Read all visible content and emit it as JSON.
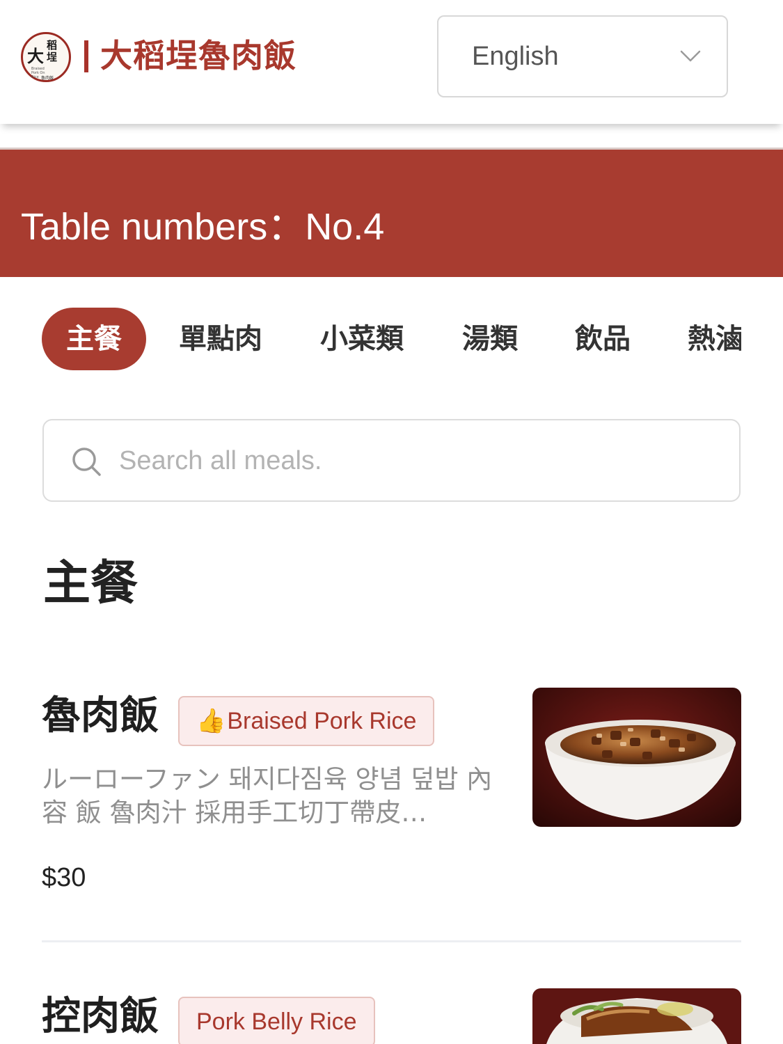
{
  "header": {
    "logo": {
      "big": "大",
      "small": "稻埕",
      "tiny": "Braised Pork On Rice",
      "mini": "魯肉飯"
    },
    "restaurant_name": "大稻埕魯肉飯",
    "language": {
      "selected": "English",
      "icon": "chevron-down-icon"
    }
  },
  "banner": {
    "table_label": "Table numbers：No.4"
  },
  "categories": [
    {
      "label": "主餐",
      "active": true
    },
    {
      "label": "單點肉",
      "active": false
    },
    {
      "label": "小菜類",
      "active": false
    },
    {
      "label": "湯類",
      "active": false
    },
    {
      "label": "飲品",
      "active": false
    },
    {
      "label": "熱滷",
      "active": false
    }
  ],
  "search": {
    "placeholder": "Search all meals.",
    "icon": "search-icon"
  },
  "section": {
    "title": "主餐"
  },
  "items": [
    {
      "name": "魯肉飯",
      "tag_icon": "👍",
      "tag": "Braised Pork Rice",
      "description": "ルーローファン 돼지다짐육 양념 덮밥 內容 飯 魯肉汁 採用手工切丁帶皮…",
      "price": "$30"
    },
    {
      "name": "控肉飯",
      "tag": "Pork Belly Rice"
    }
  ],
  "colors": {
    "brand": "#a83c30",
    "tag_bg": "#fbecec",
    "muted_text": "#8f8f8f"
  }
}
